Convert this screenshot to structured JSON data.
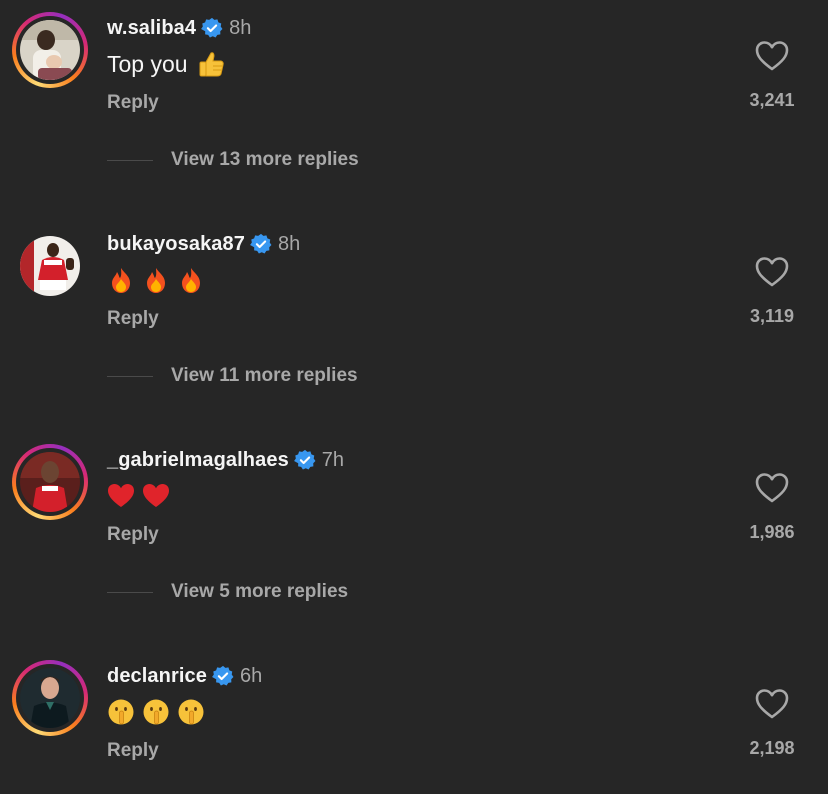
{
  "colors": {
    "background": "#262626",
    "primary_text": "#f5f5f5",
    "secondary_text": "#a8a8a8",
    "verified_badge": "#3897f0",
    "story_ring": [
      "#feda75",
      "#fa7e1e",
      "#d62976",
      "#962fbf"
    ]
  },
  "comments": [
    {
      "username": "w.saliba4",
      "verified": true,
      "time": "8h",
      "text": "Top you",
      "emojis": [
        "thumbs-up"
      ],
      "reply_label": "Reply",
      "likes": "3,241",
      "view_more": "View 13 more replies",
      "story_ring": true
    },
    {
      "username": "bukayosaka87",
      "verified": true,
      "time": "8h",
      "text": "",
      "emojis": [
        "fire",
        "fire",
        "fire"
      ],
      "reply_label": "Reply",
      "likes": "3,119",
      "view_more": "View 11 more replies",
      "story_ring": false
    },
    {
      "username": "_gabrielmagalhaes",
      "verified": true,
      "time": "7h",
      "text": "",
      "emojis": [
        "red-heart",
        "red-heart"
      ],
      "reply_label": "Reply",
      "likes": "1,986",
      "view_more": "View 5 more replies",
      "story_ring": true
    },
    {
      "username": "declanrice",
      "verified": true,
      "time": "6h",
      "text": "",
      "emojis": [
        "shushing-face",
        "shushing-face",
        "shushing-face"
      ],
      "reply_label": "Reply",
      "likes": "2,198",
      "story_ring": true
    }
  ]
}
